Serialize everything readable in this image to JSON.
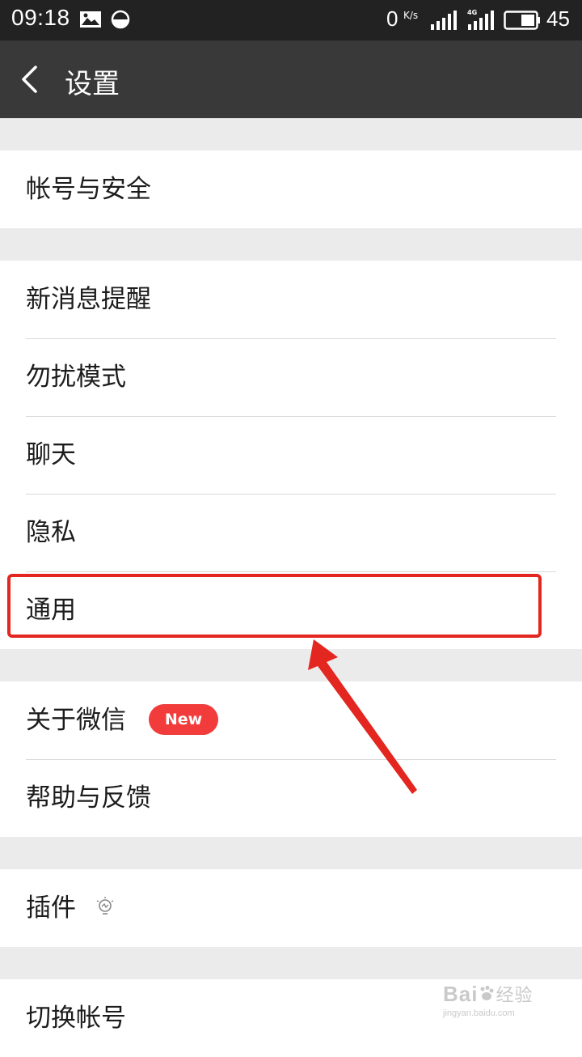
{
  "status_bar": {
    "time": "09:18",
    "net_speed": "0",
    "net_speed_unit": "K/s",
    "network_type": "4G",
    "battery": "45"
  },
  "header": {
    "title": "设置"
  },
  "groups": [
    {
      "items": [
        {
          "label": "帐号与安全"
        }
      ]
    },
    {
      "items": [
        {
          "label": "新消息提醒"
        },
        {
          "label": "勿扰模式"
        },
        {
          "label": "聊天"
        },
        {
          "label": "隐私"
        },
        {
          "label": "通用"
        }
      ]
    },
    {
      "items": [
        {
          "label": "关于微信",
          "badge": "New"
        },
        {
          "label": "帮助与反馈"
        }
      ]
    },
    {
      "items": [
        {
          "label": "插件"
        }
      ]
    },
    {
      "items": [
        {
          "label": "切换帐号"
        }
      ]
    }
  ],
  "watermark": {
    "brand_latin": "Bai",
    "brand_cn": "经验",
    "domain": "jingyan.baidu.com"
  },
  "colors": {
    "status_bar_bg": "#222222",
    "title_bar_bg": "#393939",
    "page_bg": "#ebebeb",
    "badge": "#f23c3c",
    "annotation": "#e3261f"
  }
}
